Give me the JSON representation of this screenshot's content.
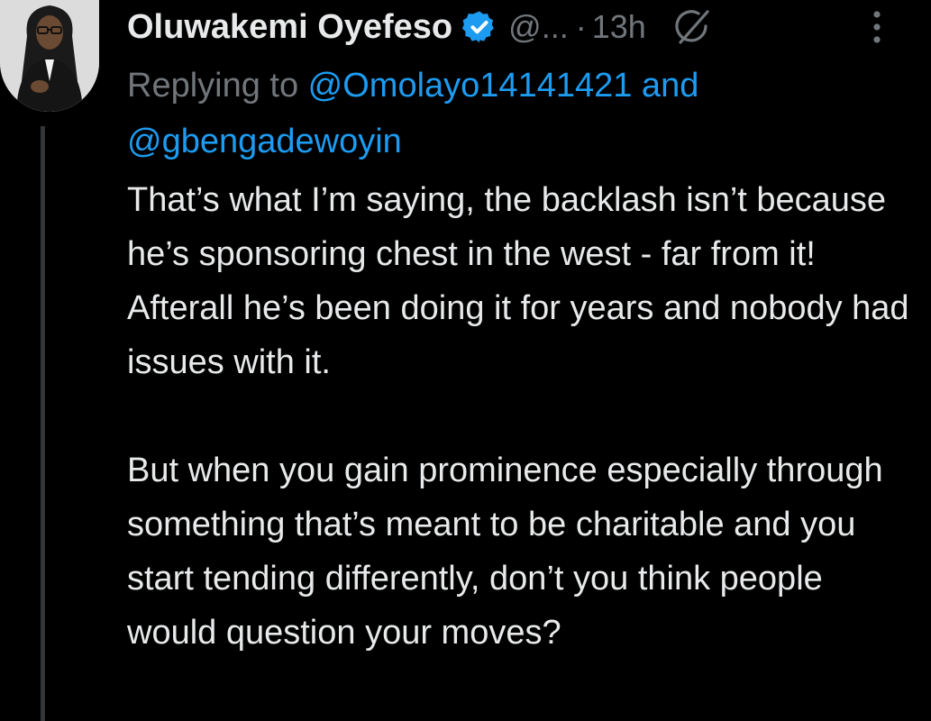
{
  "tweet": {
    "author": {
      "display_name": "Oluwakemi Oyefeso",
      "handle": "@...",
      "verified": true,
      "avatar_icon": "profile-photo"
    },
    "separator": "·",
    "time": "13h",
    "grok_icon": "grok-icon",
    "more_icon": "more-vertical-icon",
    "replying": {
      "prefix": "Replying to ",
      "mention_1": "@Omolayo14141421",
      "conjunction": " and",
      "mention_2": "@gbengadewoyin"
    },
    "text": "That’s what I’m saying, the backlash isn’t because he’s sponsoring chest in the west  - far from it! Afterall he’s been doing it for years and nobody had issues with it.\n\nBut when you gain prominence especially through something that’s meant to be charitable and you start tending differently, don’t you think people would question your moves?"
  },
  "colors": {
    "background": "#000000",
    "text_primary": "#e7e9ea",
    "text_secondary": "#71767b",
    "accent_blue": "#1d9bf0",
    "thread_line": "#333639"
  }
}
